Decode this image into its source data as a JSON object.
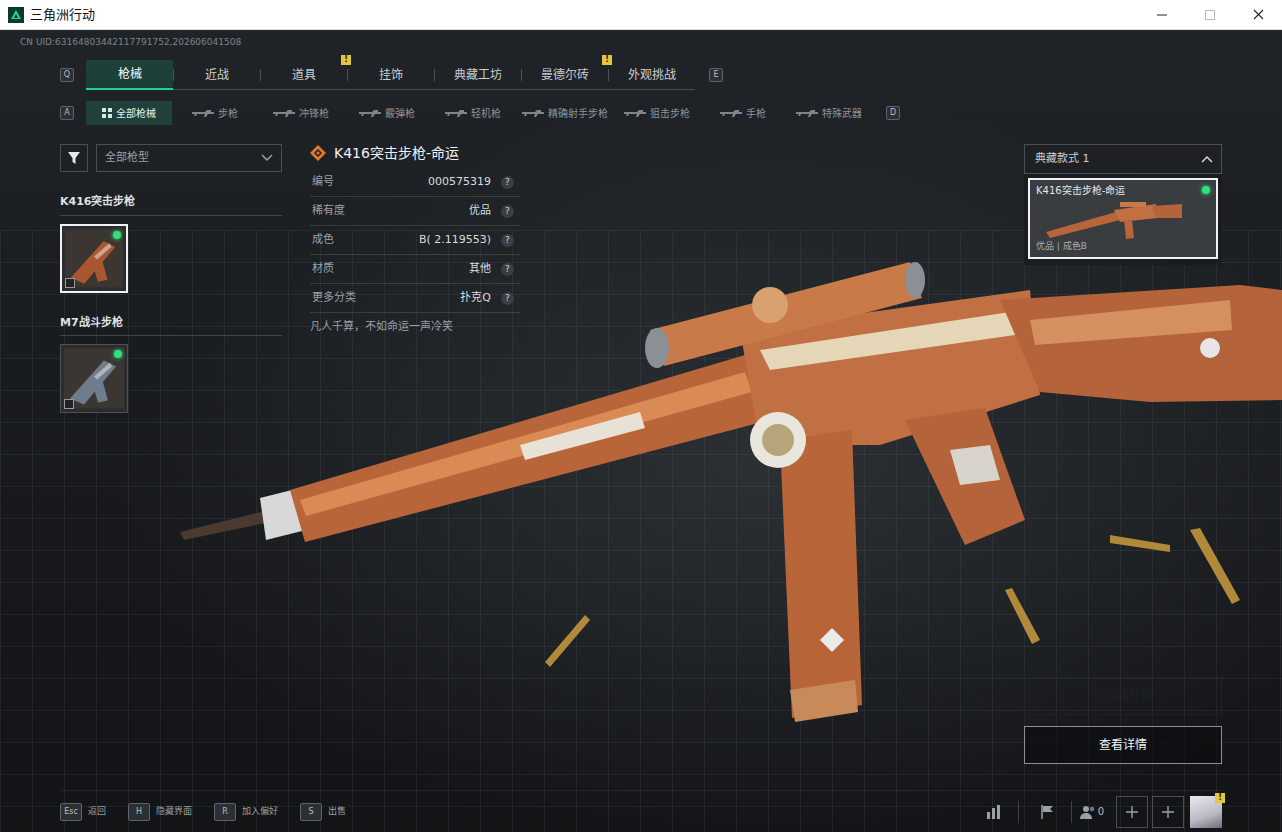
{
  "window": {
    "title": "三角洲行动",
    "uid": "CN UID:63164803442117791752,202606041508"
  },
  "tabs": {
    "prev_key": "Q",
    "next_key": "E",
    "items": [
      {
        "label": "枪械",
        "selected": true
      },
      {
        "label": "近战",
        "selected": false
      },
      {
        "label": "道具",
        "selected": false,
        "badge": "!"
      },
      {
        "label": "挂饰",
        "selected": false
      },
      {
        "label": "典藏工坊",
        "selected": false
      },
      {
        "label": "曼德尔砖",
        "selected": false,
        "badge": "!"
      },
      {
        "label": "外观挑战",
        "selected": false
      }
    ]
  },
  "subtabs": {
    "prev_key": "A",
    "next_key": "D",
    "items": [
      {
        "label": "全部枪械",
        "selected": true
      },
      {
        "label": "步枪",
        "selected": false
      },
      {
        "label": "冲锋枪",
        "selected": false
      },
      {
        "label": "霰弹枪",
        "selected": false
      },
      {
        "label": "轻机枪",
        "selected": false
      },
      {
        "label": "精确射手步枪",
        "selected": false
      },
      {
        "label": "狙击步枪",
        "selected": false
      },
      {
        "label": "手枪",
        "selected": false
      },
      {
        "label": "特殊武器",
        "selected": false
      }
    ]
  },
  "filter": {
    "value": "全部枪型"
  },
  "weapon_groups": [
    {
      "name": "K416突击步枪",
      "skins": [
        {
          "selected": true,
          "equipped": true,
          "color": "#a8572e"
        }
      ]
    },
    {
      "name": "M7战斗步枪",
      "skins": [
        {
          "selected": false,
          "equipped": true,
          "color": "#6f7c8c"
        }
      ]
    }
  ],
  "detail": {
    "title": "K416突击步枪-命运",
    "rows": [
      {
        "label": "编号",
        "value": "000575319",
        "help": "?"
      },
      {
        "label": "稀有度",
        "value": "优品",
        "help": "?"
      },
      {
        "label": "成色",
        "value": "B( 2.119553)",
        "help": "?"
      },
      {
        "label": "材质",
        "value": "其他",
        "help": "?"
      },
      {
        "label": "更多分类",
        "value": "扑克Q",
        "help": "?"
      }
    ],
    "quote": "凡人千算，不如命运一声冷笑"
  },
  "style_picker": {
    "label": "典藏款式 1",
    "expanded": true,
    "items": [
      {
        "name": "K416突击步枪-命运",
        "meta": "优品 | 成色B",
        "selected": true,
        "equipped": true
      }
    ]
  },
  "actions": [
    {
      "label": "已应用外观",
      "disabled": true
    },
    {
      "label": "查看详情",
      "disabled": false
    }
  ],
  "hints": [
    {
      "key": "Esc",
      "label": "返回"
    },
    {
      "key": "H",
      "label": "隐藏界面"
    },
    {
      "key": "R",
      "label": "加入偏好"
    },
    {
      "key": "S",
      "label": "出售"
    }
  ],
  "toolbar": {
    "friends_count": "0",
    "avatar_badge": "!"
  }
}
